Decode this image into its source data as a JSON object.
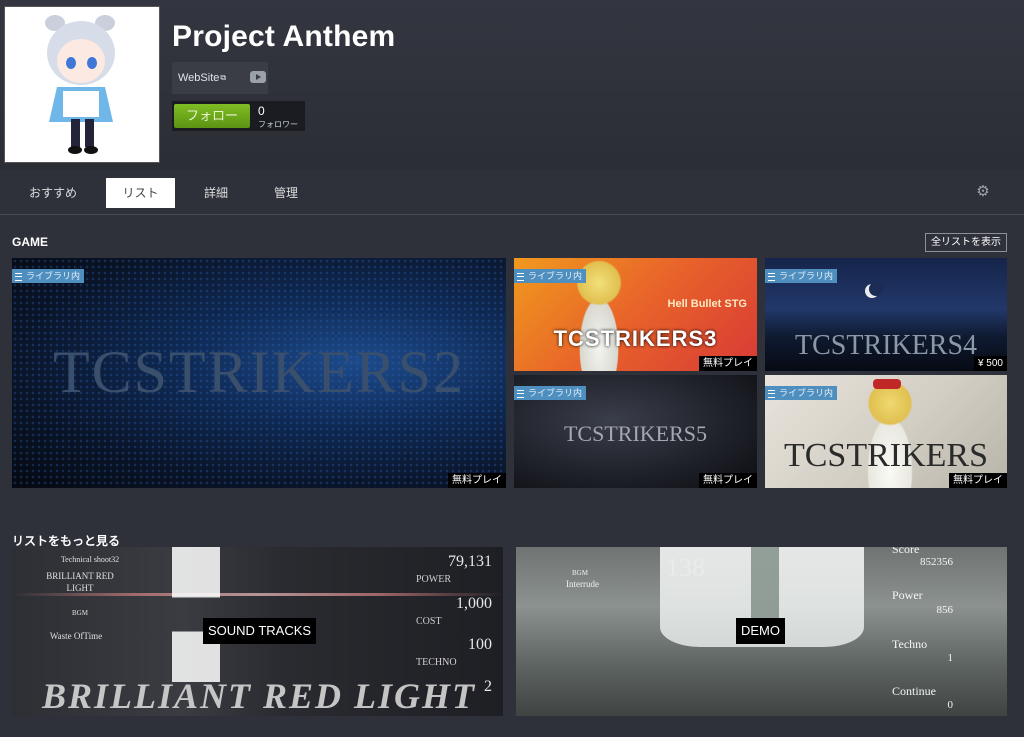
{
  "header": {
    "title": "Project Anthem",
    "website_label": "WebSite",
    "external_glyph": "⧉",
    "youtube_icon": "youtube-icon",
    "follow_label": "フォロー",
    "follower_count": "0",
    "follower_label": "フォロワー"
  },
  "tabs": [
    {
      "label": "おすすめ"
    },
    {
      "label": "リスト",
      "active": true
    },
    {
      "label": "詳細"
    },
    {
      "label": "管理"
    }
  ],
  "gear_glyph": "⚙",
  "game_section": {
    "title": "GAME",
    "show_all": "全リストを表示",
    "tiles": [
      {
        "logo": "TCSTRIKERS2",
        "badge": "ライブラリ内",
        "price": "無料プレイ"
      },
      {
        "logo": "TCSTRIKERS3",
        "subtitle": "Hell Bullet STG",
        "badge": "ライブラリ内",
        "price": "無料プレイ"
      },
      {
        "logo": "TCSTRIKERS4",
        "badge": "ライブラリ内",
        "price": "¥ 500"
      },
      {
        "logo": "TCSTRIKERS5",
        "badge": "ライブラリ内",
        "price": "無料プレイ"
      },
      {
        "logo": "TCSTRIKERS",
        "badge": "ライブラリ内",
        "price": "無料プレイ"
      }
    ]
  },
  "more_section": {
    "title": "リストをもっと見る",
    "soundtracks": {
      "caption": "SOUND TRACKS",
      "art": {
        "top_left": "Technical shoot32",
        "song_line1": "BRILLIANT RED",
        "song_line2": "LIGHT",
        "bgm": "BGM",
        "waste": "Waste OfTime",
        "stat1_value": "79,131",
        "stat1_label": "POWER",
        "stat2_value": "1,000",
        "stat2_label": "COST",
        "stat3_value": "100",
        "stat3_label": "TECHNO",
        "stat4_value": "2",
        "big_text": "BRILLIANT RED LIGHT"
      }
    },
    "demo": {
      "caption": "DEMO",
      "art": {
        "bgm": "BGM",
        "track": "Interrude",
        "big_num": "138",
        "score_label": "Score",
        "score_value": "852356",
        "power_label": "Power",
        "power_value": "856",
        "techno_label": "Techno",
        "techno_value": "1",
        "continue_label": "Continue",
        "continue_value": "0"
      }
    }
  }
}
